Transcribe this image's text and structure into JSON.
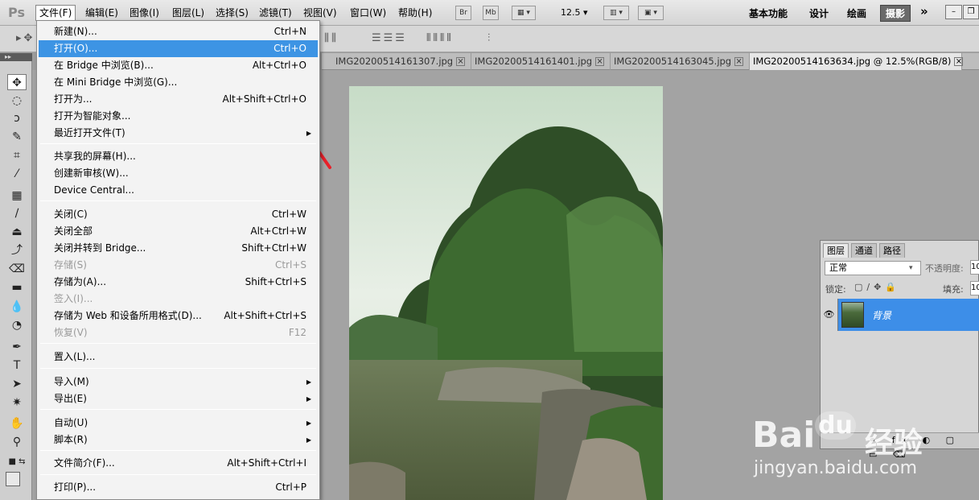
{
  "app": {
    "logo": "Ps"
  },
  "menubar": {
    "items": [
      "文件(F)",
      "编辑(E)",
      "图像(I)",
      "图层(L)",
      "选择(S)",
      "滤镜(T)",
      "视图(V)",
      "窗口(W)",
      "帮助(H)"
    ],
    "buttons": [
      "Br",
      "Mb"
    ],
    "zoom": "12.5",
    "workspaces": [
      "基本功能",
      "设计",
      "绘画",
      "摄影"
    ],
    "more": "»",
    "win_min": "–",
    "win_restore": "❐"
  },
  "doc_tabs": [
    {
      "label": "IMG20200514161307.jpg"
    },
    {
      "label": "IMG20200514161401.jpg"
    },
    {
      "label": "IMG20200514163045.jpg"
    },
    {
      "label": "IMG20200514163634.jpg @ 12.5%(RGB/8)"
    }
  ],
  "tab_close": "⨯",
  "file_menu": {
    "items": [
      {
        "label": "新建(N)...",
        "shortcut": "Ctrl+N"
      },
      {
        "label": "打开(O)...",
        "shortcut": "Ctrl+O",
        "highlighted": true
      },
      {
        "label": "在 Bridge 中浏览(B)...",
        "shortcut": "Alt+Ctrl+O"
      },
      {
        "label": "在 Mini Bridge 中浏览(G)...",
        "shortcut": ""
      },
      {
        "label": "打开为...",
        "shortcut": "Alt+Shift+Ctrl+O"
      },
      {
        "label": "打开为智能对象...",
        "shortcut": ""
      },
      {
        "label": "最近打开文件(T)",
        "shortcut": "",
        "submenu": true
      },
      {
        "label": "共享我的屏幕(H)...",
        "shortcut": ""
      },
      {
        "label": "创建新审核(W)...",
        "shortcut": ""
      },
      {
        "label": "Device Central...",
        "shortcut": ""
      },
      {
        "label": "关闭(C)",
        "shortcut": "Ctrl+W"
      },
      {
        "label": "关闭全部",
        "shortcut": "Alt+Ctrl+W"
      },
      {
        "label": "关闭并转到 Bridge...",
        "shortcut": "Shift+Ctrl+W"
      },
      {
        "label": "存储(S)",
        "shortcut": "Ctrl+S",
        "disabled": true
      },
      {
        "label": "存储为(A)...",
        "shortcut": "Shift+Ctrl+S"
      },
      {
        "label": "签入(I)...",
        "shortcut": "",
        "disabled": true
      },
      {
        "label": "存储为 Web 和设备所用格式(D)...",
        "shortcut": "Alt+Shift+Ctrl+S"
      },
      {
        "label": "恢复(V)",
        "shortcut": "F12",
        "disabled": true
      },
      {
        "label": "置入(L)...",
        "shortcut": ""
      },
      {
        "label": "导入(M)",
        "shortcut": "",
        "submenu": true
      },
      {
        "label": "导出(E)",
        "shortcut": "",
        "submenu": true
      },
      {
        "label": "自动(U)",
        "shortcut": "",
        "submenu": true
      },
      {
        "label": "脚本(R)",
        "shortcut": "",
        "submenu": true
      },
      {
        "label": "文件简介(F)...",
        "shortcut": "Alt+Shift+Ctrl+I"
      },
      {
        "label": "打印(P)...",
        "shortcut": "Ctrl+P"
      }
    ]
  },
  "layers_panel": {
    "tabs": [
      "图层",
      "通道",
      "路径"
    ],
    "blend_mode": "正常",
    "opacity_label": "不透明度:",
    "opacity_value": "10",
    "lock_label": "锁定:",
    "fill_label": "填充:",
    "fill_value": "10",
    "layer_name": "背景"
  },
  "watermark": {
    "brand_a": "Bai",
    "brand_b": "du",
    "brand_c": "经验",
    "url": "jingyan.baidu.com"
  },
  "colors": {
    "highlight": "#3d94e4",
    "annotation_arrow": "#e8202a"
  }
}
